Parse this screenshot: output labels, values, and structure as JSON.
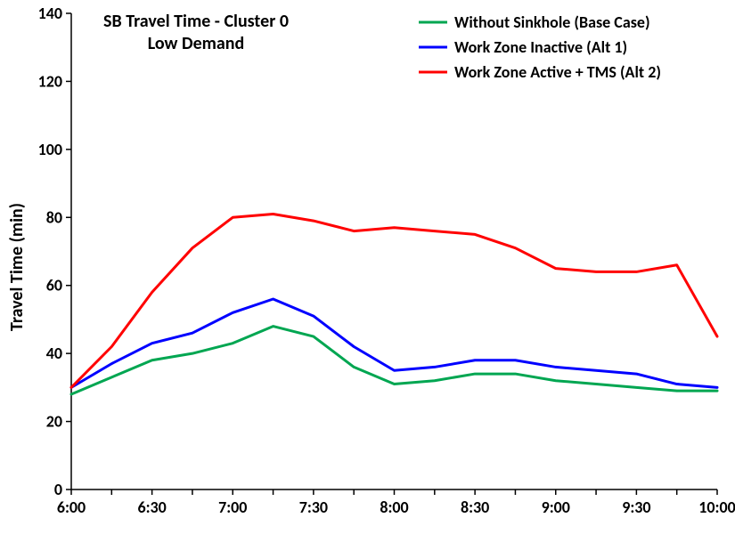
{
  "chart_data": {
    "type": "line",
    "title": "SB Travel Time - Cluster 0",
    "subtitle": "Low Demand",
    "xlabel": "",
    "ylabel": "Travel Time (min)",
    "ylim": [
      0,
      140
    ],
    "ytick_step": 20,
    "x_categories": [
      "6:00",
      "6:15",
      "6:30",
      "6:45",
      "7:00",
      "7:15",
      "7:30",
      "7:45",
      "8:00",
      "8:15",
      "8:30",
      "8:45",
      "9:00",
      "9:15",
      "9:30",
      "9:45",
      "10:00"
    ],
    "x_tick_labels": [
      "6:00",
      "6:30",
      "7:00",
      "7:30",
      "8:00",
      "8:30",
      "9:00",
      "9:30",
      "10:00"
    ],
    "series": [
      {
        "name": "Without Sinkhole (Base Case)",
        "color": "#00a651",
        "values": [
          28,
          33,
          38,
          40,
          43,
          48,
          45,
          36,
          31,
          32,
          34,
          34,
          32,
          31,
          30,
          29,
          29
        ]
      },
      {
        "name": "Work Zone Inactive (Alt 1)",
        "color": "#0000ff",
        "values": [
          30,
          37,
          43,
          46,
          52,
          56,
          51,
          42,
          35,
          36,
          38,
          38,
          36,
          35,
          34,
          31,
          30
        ]
      },
      {
        "name": "Work Zone Active + TMS (Alt 2)",
        "color": "#ff0000",
        "values": [
          30,
          42,
          58,
          71,
          80,
          81,
          79,
          76,
          77,
          76,
          75,
          71,
          65,
          64,
          64,
          66,
          45
        ]
      }
    ]
  }
}
